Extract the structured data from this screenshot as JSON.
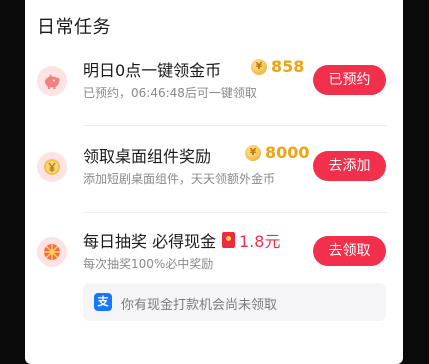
{
  "section": {
    "title": "日常任务"
  },
  "tasks": [
    {
      "icon": "piggy-bank-icon",
      "title": "明日0点一键领金币",
      "reward_icon": "coin-icon",
      "reward_icon_text": "¥",
      "reward_value": "858",
      "subtitle": "已预约，06:46:48后可一键领取",
      "button_label": "已预约"
    },
    {
      "icon": "yuan-coin-icon",
      "title": "领取桌面组件奖励",
      "reward_icon": "coin-icon",
      "reward_icon_text": "¥",
      "reward_value": "8000",
      "subtitle": "添加短剧桌面组件，天天领额外金币",
      "button_label": "去添加"
    },
    {
      "icon": "prize-wheel-icon",
      "title": "每日抽奖 必得现金",
      "reward_icon": "red-envelope-icon",
      "reward_value": "1.8元",
      "subtitle": "每次抽奖100%必中奖励",
      "button_label": "去领取"
    }
  ],
  "notice": {
    "icon": "alipay-icon",
    "icon_glyph": "支",
    "text": "你有现金打款机会尚未领取"
  },
  "colors": {
    "accent": "#f2304c",
    "reward": "#f0a211",
    "icon_bg": "#fde3e3",
    "alipay": "#1677ff"
  }
}
